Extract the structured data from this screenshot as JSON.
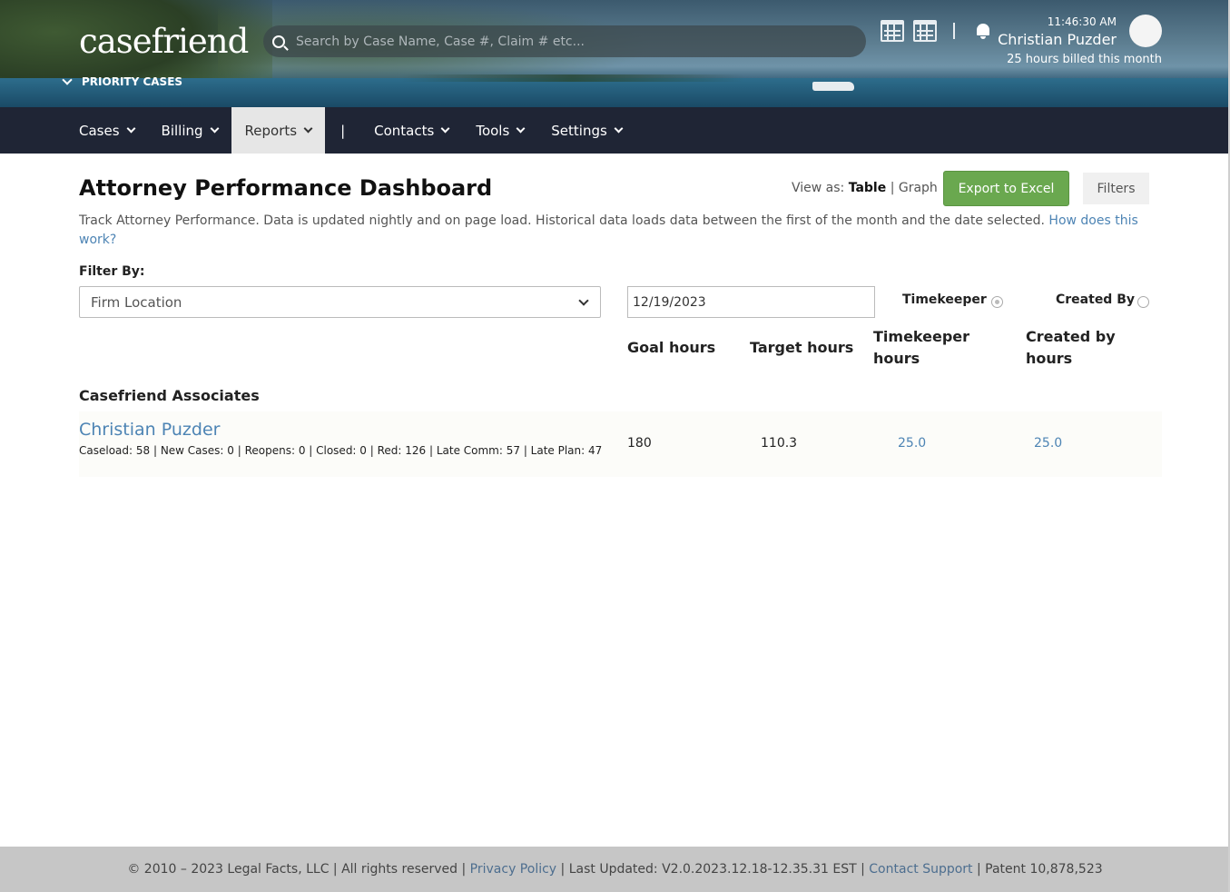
{
  "header": {
    "logo": "casefriend",
    "priority_label": "PRIORITY CASES",
    "search_placeholder": "Search by Case Name, Case #, Claim # etc...",
    "time": "11:46:30 AM",
    "user_name": "Christian Puzder",
    "billed": "25 hours billed this month"
  },
  "nav": {
    "items": [
      {
        "label": "Cases"
      },
      {
        "label": "Billing"
      },
      {
        "label": "Reports"
      },
      {
        "label": "Contacts"
      },
      {
        "label": "Tools"
      },
      {
        "label": "Settings"
      }
    ],
    "separator": "|"
  },
  "page": {
    "title": "Attorney Performance Dashboard",
    "view_as_label": "View as:",
    "view_table": "Table",
    "view_sep": "|",
    "view_graph": "Graph",
    "export_label": "Export to Excel",
    "filters_label": "Filters",
    "description": "Track Attorney Performance. Data is updated nightly and on page load. Historical data loads data between the first of the month and the date selected.",
    "help_link": "How does this work?",
    "filter_by_label": "Filter By:",
    "location_value": "Firm Location",
    "date_value": "12/19/2023",
    "radio_timekeeper": "Timekeeper",
    "radio_created_by": "Created By"
  },
  "table": {
    "headers": {
      "goal": "Goal hours",
      "target": "Target hours",
      "timekeeper_1": "Timekeeper",
      "timekeeper_2": "hours",
      "created_1": "Created by",
      "created_2": "hours"
    },
    "group": "Casefriend Associates",
    "rows": [
      {
        "name": "Christian Puzder",
        "stats": "Caseload: 58 | New Cases: 0 | Reopens: 0 | Closed: 0 | Red: 126 | Late Comm: 57 | Late Plan: 47",
        "goal": "180",
        "target": "110.3",
        "timekeeper_hours": "25.0",
        "created_hours": "25.0"
      }
    ]
  },
  "footer": {
    "copyright": "© 2010 – 2023 Legal Facts, LLC | All rights reserved | ",
    "privacy": "Privacy Policy",
    "updated": " | Last Updated: V2.0.2023.12.18-12.35.31 EST | ",
    "support": "Contact Support",
    "patent": " | Patent 10,878,523"
  }
}
